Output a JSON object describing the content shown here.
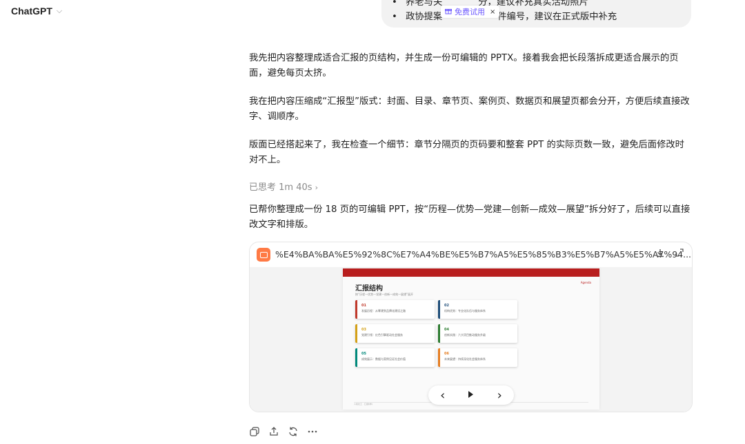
{
  "app": {
    "title": "ChatGPT"
  },
  "user_message": {
    "bullets": [
      "养老与关",
      "政协提案",
      "件编号，建议在正式版中补充"
    ],
    "bullet1_tail": "分，建议补充真实活动照片",
    "chip_label": "免费试用",
    "chip_close": "×"
  },
  "assistant": {
    "p1": "我先把内容整理成适合汇报的页结构，并生成一份可编辑的 PPTX。接着我会把长段落拆成更适合展示的页面，避免每页太挤。",
    "p2": "我在把内容压缩成“汇报型”版式：封面、目录、章节页、案例页、数据页和展望页都会分开，方便后续直接改字、调顺序。",
    "p3": "版面已经搭起来了，我在检查一个细节：章节分隔页的页码要和整套 PPT 的实际页数一致，避免后面修改时对不上。",
    "thought": "已思考 1m 40s",
    "p4": "已帮你整理成一份 18 页的可编辑 PPT，按“历程—优势—党建—创新—成效—展望”拆分好了，后续可以直接改文字和排版。"
  },
  "file": {
    "name": "%E4%BA%BA%E5%92%8C%E7%A4%BE%E5%B7%A5%E5%85%B3%E5%B7%A5%E5%A7%94...",
    "slide": {
      "title": "汇报结构",
      "subtitle": "按“历程—优势—党建—创新—成效—展望”展开",
      "brand": "Agenda",
      "items": [
        {
          "num": "01",
          "label": "发展历程：从筹建到品牌化建设之路",
          "color": "#c0392b"
        },
        {
          "num": "02",
          "label": "机构优势：专业化队伍与服务体系",
          "color": "#1f4e79"
        },
        {
          "num": "03",
          "label": "党建引领：红色引擎驱动社会服务",
          "color": "#d4a017"
        },
        {
          "num": "04",
          "label": "创新实践：六大项目推动服务升级",
          "color": "#2e7d32"
        },
        {
          "num": "05",
          "label": "成效展示：数据与案例见证社会价值",
          "color": "#00897b"
        },
        {
          "num": "06",
          "label": "未来展望：持续深化社会服务体系",
          "color": "#e67e22"
        }
      ],
      "footer": "人和社工 · 汇报材料"
    }
  },
  "nav": {
    "prev": "‹",
    "next": "›"
  },
  "icons": [
    "copy-icon",
    "share-icon",
    "regenerate-icon",
    "more-icon"
  ],
  "colors": {
    "accent_purple": "#6b57ff",
    "file_orange": "#ff7a45",
    "slide_red": "#b81e1e"
  }
}
